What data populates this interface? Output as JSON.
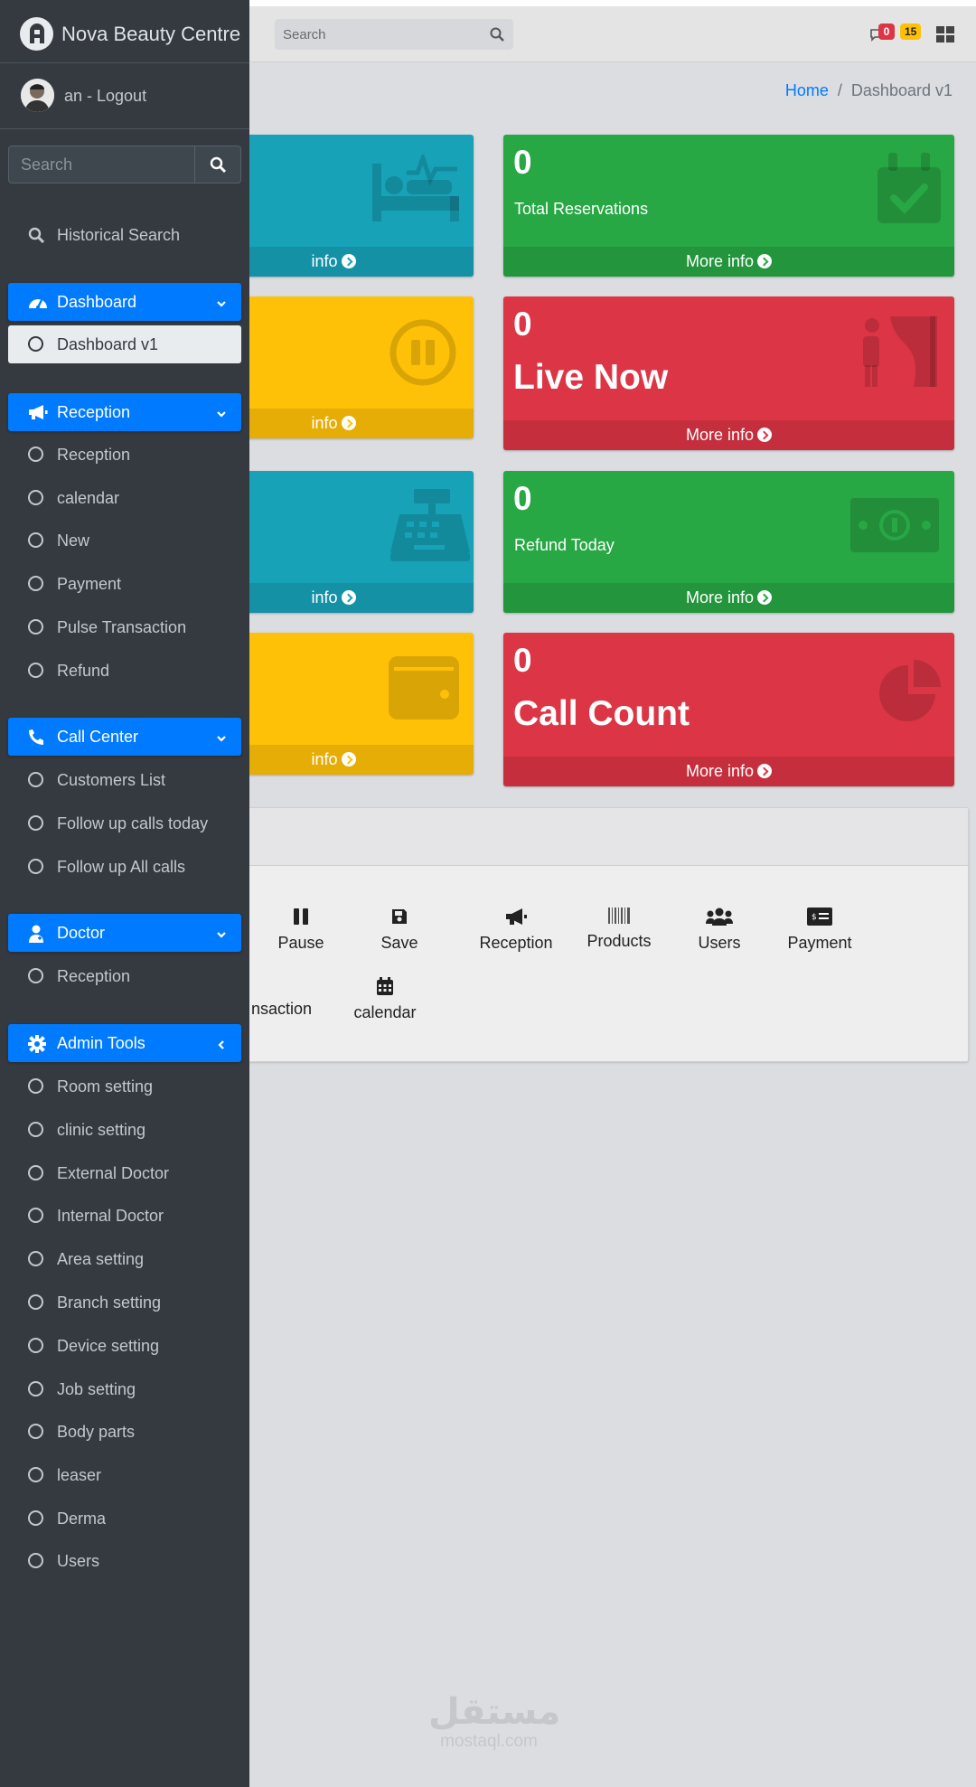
{
  "navbar": {
    "search_placeholder": "Search",
    "messages_count": "0",
    "notifications_count": "15"
  },
  "breadcrumb": {
    "home": "Home",
    "current": "Dashboard v1"
  },
  "info_boxes": [
    {
      "color": "teal",
      "footer": "info",
      "icon": "bed-pulse-icon"
    },
    {
      "color": "green",
      "value": "0",
      "label": "Total Reservations",
      "footer": "More info",
      "icon": "calendar-check-icon"
    },
    {
      "color": "yellow",
      "footer": "info",
      "icon": "pause-circle-icon"
    },
    {
      "color": "red",
      "value": "0",
      "label": "Live Now",
      "footer": "More info",
      "icon": "person-curtain-icon"
    },
    {
      "color": "teal",
      "footer": "info",
      "icon": "cash-register-icon"
    },
    {
      "color": "green",
      "value": "0",
      "label": "Refund Today",
      "footer": "More info",
      "icon": "money-bill-icon"
    },
    {
      "color": "yellow",
      "footer": "info",
      "icon": "wallet-icon"
    },
    {
      "color": "red",
      "value": "0",
      "label": "Call Count",
      "footer": "More info",
      "icon": "pie-chart-icon"
    }
  ],
  "colors": {
    "teal": "#17a2b8",
    "green": "#28a745",
    "yellow": "#ffc107",
    "red": "#dc3545",
    "primary": "#007bff",
    "sidebar": "#343a40"
  },
  "quick_actions": {
    "row1": [
      "Pause",
      "Save",
      "Reception",
      "Products",
      "Users",
      "Payment"
    ],
    "row2": [
      "nsaction",
      "calendar"
    ]
  },
  "watermark": {
    "arabic": "مستقل",
    "latin": "mostaql.com"
  },
  "sidebar": {
    "brand": "Nova Beauty Centre",
    "user": "an - Logout",
    "search_placeholder": "Search",
    "historical": "Historical Search",
    "sections": [
      {
        "label": "Dashboard",
        "items": [
          "Dashboard v1"
        ]
      },
      {
        "label": "Reception",
        "items": [
          "Reception",
          "calendar",
          "New",
          "Payment",
          "Pulse Transaction",
          "Refund"
        ]
      },
      {
        "label": "Call Center",
        "items": [
          "Customers List",
          "Follow up calls today",
          "Follow up All calls"
        ]
      },
      {
        "label": "Doctor",
        "items": [
          "Reception"
        ]
      },
      {
        "label": "Admin Tools",
        "items": [
          "Room setting",
          "clinic setting",
          "External Doctor",
          "Internal Doctor",
          "Area setting",
          "Branch setting",
          "Device setting",
          "Job setting",
          "Body parts",
          "leaser",
          "Derma",
          "Users"
        ]
      }
    ]
  }
}
